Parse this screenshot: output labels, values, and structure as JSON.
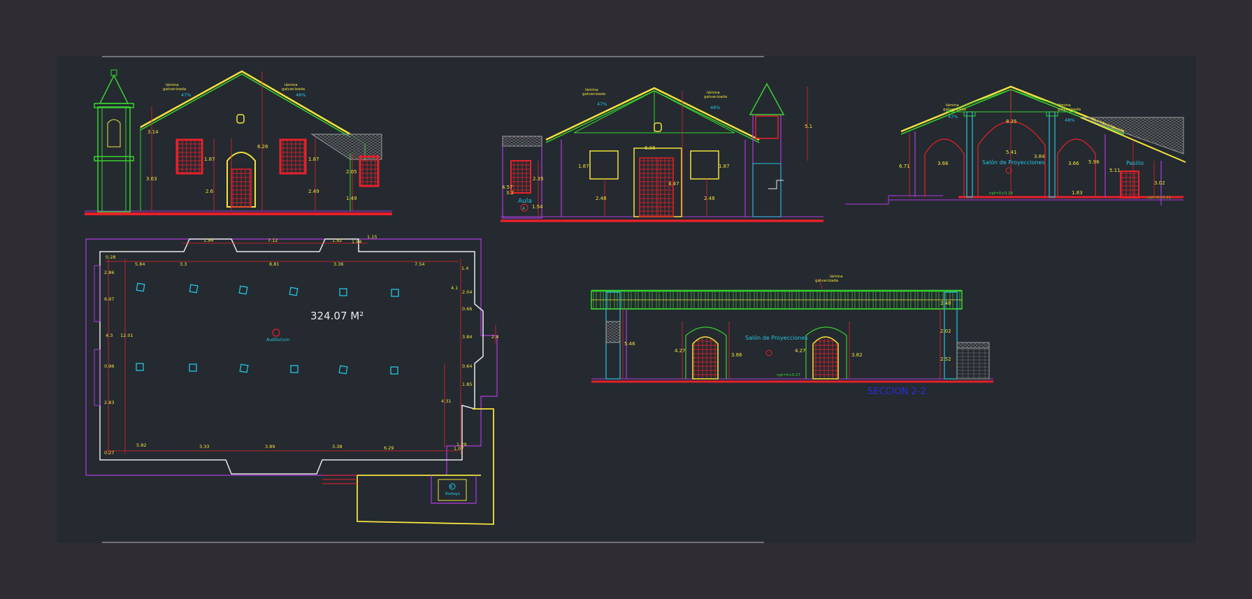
{
  "colors": {
    "background_outer": "#2f2d33",
    "background_model": "#242a30",
    "yellow": "#f4e33c",
    "green": "#39d12f",
    "red": "#e8202a",
    "magenta": "#b03be0",
    "white": "#e9e9e9",
    "cyan": "#24c5e0",
    "blue": "#2a2ad8",
    "gray": "#8a8a8a"
  },
  "elevation1": {
    "roof_left_label": [
      "lámina",
      "galvanizada"
    ],
    "roof_left_slope": "47%",
    "roof_right_label": [
      "lámina",
      "galvanizada"
    ],
    "roof_right_slope": "48%",
    "dims": [
      "3.14",
      "3.63",
      "1.87",
      "6.26",
      "1.87",
      "2.6",
      "2.49",
      "2.05",
      "1.49"
    ]
  },
  "elevation2": {
    "roof_left_label": [
      "lámina",
      "galvanizada"
    ],
    "roof_left_slope": "47%",
    "roof_right_label": [
      "lámina",
      "galvanizada"
    ],
    "roof_right_slope": "48%",
    "room_label": "Aula",
    "room_tag": "A",
    "dims": [
      "5.1",
      "6.08",
      "1.87",
      "1.87",
      "2.35",
      "4.57",
      "3.2",
      "4.47",
      "2.48",
      "2.48",
      "1.54"
    ]
  },
  "section1": {
    "roof_left_label": [
      "lámina",
      "galvanizada"
    ],
    "roof_left_slope": "47%",
    "roof_right_label": [
      "lámina",
      "galvanizada"
    ],
    "roof_right_slope": "48%",
    "room_label": "Salón de Proyecciones",
    "corridor_label": "Pasillo",
    "level_1": "npt=0+0.24",
    "level_2": "npt=0+0.11",
    "dims": [
      "8.35",
      "5.41",
      "6.71",
      "3.66",
      "3.84",
      "3.66",
      "5.96",
      "5.11",
      "1.83",
      "3.02"
    ]
  },
  "plan": {
    "area": "324.07 M²",
    "room_label": "Auditorium",
    "storage_label": "Bodega",
    "storage_tag": "B",
    "top_dims": [
      "1.94",
      "7.12",
      "1.92",
      "1.94",
      "1.15"
    ],
    "inner_top_dims": [
      "0.28",
      "5.84",
      "3.3",
      "8.81",
      "3.36",
      "7.54",
      "1.4"
    ],
    "bottom_dims": [
      "5.82",
      "3.33",
      "3.89",
      "3.38",
      "6.29",
      "1.07",
      "1.29"
    ],
    "left_dims": [
      "2.86",
      "6.97",
      "4.3",
      "12.01",
      "0.96",
      "2.83",
      "0.27"
    ],
    "right_dims": [
      "4.1",
      "2.04",
      "0.66",
      "3.84",
      "2.4",
      "0.64",
      "1.85",
      "4.31"
    ]
  },
  "section2": {
    "roof_label": [
      "lámina",
      "galvanizada"
    ],
    "room_label": "Salón de Proyecciones",
    "level": "npt=0+0.27",
    "title": "SECCION 2-2",
    "dims": [
      "5.46",
      "4.27",
      "3.86",
      "4.27",
      "3.82",
      "2.48",
      "2.02",
      "2.52"
    ]
  }
}
